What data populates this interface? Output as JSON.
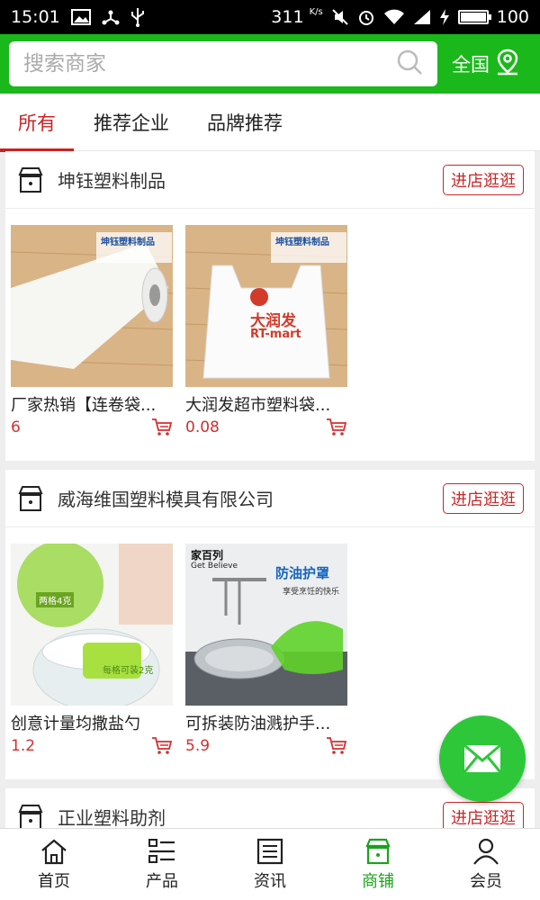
{
  "status_bar": {
    "time": "15:01",
    "speed": "311",
    "speed_unit": "K/s",
    "battery": "100"
  },
  "search": {
    "placeholder": "搜索商家",
    "region_label": "全国"
  },
  "tabs": [
    {
      "label": "所有",
      "active": true
    },
    {
      "label": "推荐企业",
      "active": false
    },
    {
      "label": "品牌推荐",
      "active": false
    }
  ],
  "shops": [
    {
      "name": "坤钰塑料制品",
      "enter_label": "进店逛逛",
      "products": [
        {
          "title": "厂家热销【连卷袋...",
          "price": "6",
          "image": "roll-bag"
        },
        {
          "title": "大润发超市塑料袋...",
          "price": "0.08",
          "image": "shopping-bag"
        }
      ]
    },
    {
      "name": "威海维国塑料模具有限公司",
      "enter_label": "进店逛逛",
      "products": [
        {
          "title": "创意计量均撒盐勺",
          "price": "1.2",
          "image": "salt-spoon"
        },
        {
          "title": "可拆装防油溅护手...",
          "price": "5.9",
          "image": "oil-guard"
        }
      ]
    },
    {
      "name": "正业塑料助剂",
      "enter_label": "进店逛逛",
      "products": []
    }
  ],
  "image_text": {
    "brand1": "坤钰塑料制品",
    "bag_brand": "大润发",
    "bag_brand_en": "RT-mart",
    "spoon_tag1": "两格4克",
    "spoon_tag2": "每格可装2克",
    "guard_brand": "家百列",
    "guard_brand_en": "Get Believe",
    "guard_title": "防油护罩",
    "guard_sub": "享受烹饪的快乐"
  },
  "bottom_nav": [
    {
      "label": "首页",
      "icon": "home-icon",
      "active": false
    },
    {
      "label": "产品",
      "icon": "product-list-icon",
      "active": false
    },
    {
      "label": "资讯",
      "icon": "news-icon",
      "active": false
    },
    {
      "label": "商铺",
      "icon": "shop-icon",
      "active": true
    },
    {
      "label": "会员",
      "icon": "member-icon",
      "active": false
    }
  ],
  "colors": {
    "brand_green": "#1bb81b",
    "accent_red": "#cc2222",
    "price_red": "#d32f2f",
    "float_green": "#2ec73a"
  }
}
